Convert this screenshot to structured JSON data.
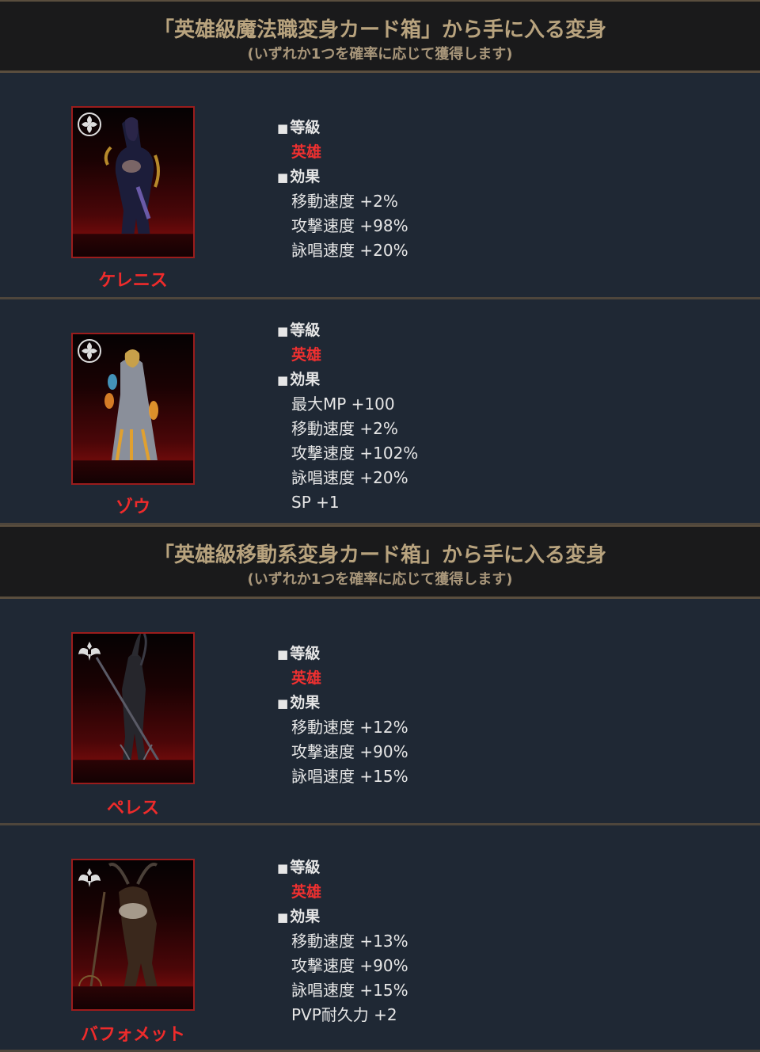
{
  "sections": [
    {
      "title": "「英雄級魔法職変身カード箱」から手に入る変身",
      "subtitle": "(いずれか1つを確率に応じて獲得します)",
      "cards": [
        {
          "name": "ケレニス",
          "grade_label": "等級",
          "grade": "英雄",
          "effects_label": "効果",
          "effects": [
            "移動速度 +2%",
            "攻撃速度 +98%",
            "詠唱速度 +20%"
          ],
          "icon": "mage-class-emblem-icon"
        },
        {
          "name": "ゾウ",
          "grade_label": "等級",
          "grade": "英雄",
          "effects_label": "効果",
          "effects": [
            "最大MP +100",
            "移動速度 +2%",
            "攻撃速度 +102%",
            "詠唱速度 +20%",
            "SP +1"
          ],
          "icon": "mage-class-emblem-icon"
        }
      ]
    },
    {
      "title": "「英雄級移動系変身カード箱」から手に入る変身",
      "subtitle": "(いずれか1つを確率に応じて獲得します)",
      "cards": [
        {
          "name": "ペレス",
          "grade_label": "等級",
          "grade": "英雄",
          "effects_label": "効果",
          "effects": [
            "移動速度 +12%",
            "攻撃速度 +90%",
            "詠唱速度 +15%"
          ],
          "icon": "winged-emblem-icon"
        },
        {
          "name": "バフォメット",
          "grade_label": "等級",
          "grade": "英雄",
          "effects_label": "効果",
          "effects": [
            "移動速度 +13%",
            "攻撃速度 +90%",
            "詠唱速度 +15%",
            "PVP耐久力 +2"
          ],
          "icon": "winged-emblem-icon"
        }
      ]
    }
  ],
  "colors": {
    "background": "#1f2834",
    "header_bg": "#1a1a1b",
    "header_title": "#b8a37e",
    "accent_red": "#ee2b2b",
    "grade_red": "#f03030",
    "divider": "#5a4e3e"
  }
}
